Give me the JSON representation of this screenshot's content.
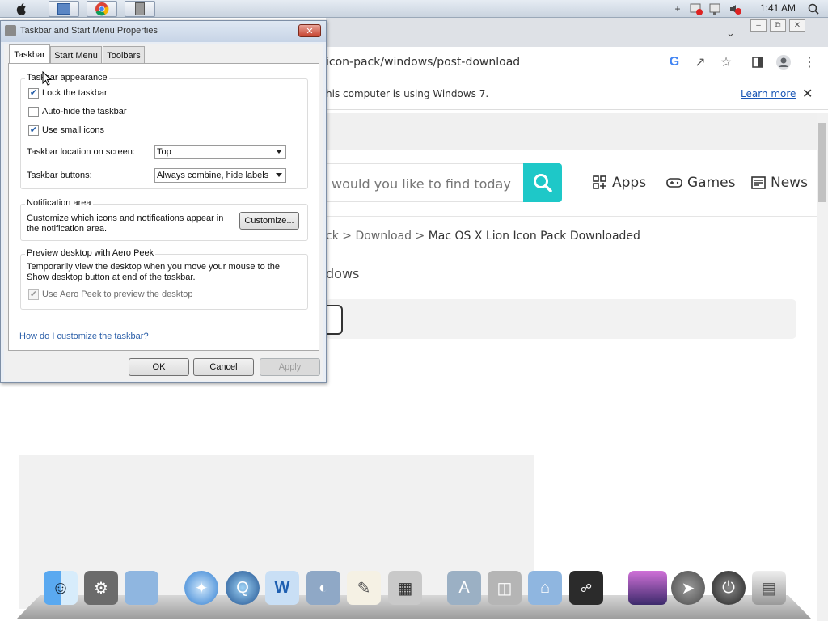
{
  "topbar": {
    "clock": "1:41 AM",
    "app_buttons": [
      "finder-icon",
      "explorer-icon",
      "chrome-icon",
      "taskbar-properties-icon"
    ],
    "tray": [
      "add-icon",
      "network-blocked-icon",
      "network-icon",
      "volume-muted-icon",
      "search-icon"
    ]
  },
  "browser": {
    "url": "icon-pack/windows/post-download",
    "info_text": "his computer is using Windows 7.",
    "learn_more": "Learn more",
    "search_placeholder": "would you like to find today",
    "nav": [
      {
        "label": "Apps",
        "icon": "apps-grid-icon"
      },
      {
        "label": "Games",
        "icon": "gamepad-icon"
      },
      {
        "label": "News",
        "icon": "news-icon"
      }
    ],
    "breadcrumb": {
      "part1": "ck",
      "sep1": ">",
      "part2": "Download",
      "sep2": ">",
      "current": "Mac OS X Lion Icon Pack Downloaded"
    },
    "subheading": "dows",
    "accent": "#1ec8c8"
  },
  "dialog": {
    "title": "Taskbar and Start Menu Properties",
    "tabs": [
      "Taskbar",
      "Start Menu",
      "Toolbars"
    ],
    "appearance": {
      "label": "Taskbar appearance",
      "lock": {
        "label": "Lock the taskbar",
        "checked": true
      },
      "autohide": {
        "label": "Auto-hide the taskbar",
        "checked": false
      },
      "small_icons": {
        "label": "Use small icons",
        "checked": true
      },
      "location_label": "Taskbar location on screen:",
      "location_value": "Top",
      "buttons_label": "Taskbar buttons:",
      "buttons_value": "Always combine, hide labels"
    },
    "notification": {
      "label": "Notification area",
      "text": "Customize which icons and notifications appear in the notification area.",
      "button": "Customize..."
    },
    "aero": {
      "label": "Preview desktop with Aero Peek",
      "text": "Temporarily view the desktop when you move your mouse to the Show desktop button at end of the taskbar.",
      "checkbox": {
        "label": "Use Aero Peek to preview the desktop",
        "checked": true
      }
    },
    "help_link": "How do I customize the taskbar?",
    "ok": "OK",
    "cancel": "Cancel",
    "apply": "Apply"
  },
  "dock": {
    "items": [
      "finder",
      "system-preferences",
      "folder",
      "safari",
      "quicktime",
      "word",
      "photos",
      "textedit",
      "calculator",
      "app-store",
      "disk-utility",
      "library-folder",
      "dashboard",
      "desktop",
      "launchpad",
      "power",
      "trash"
    ]
  }
}
